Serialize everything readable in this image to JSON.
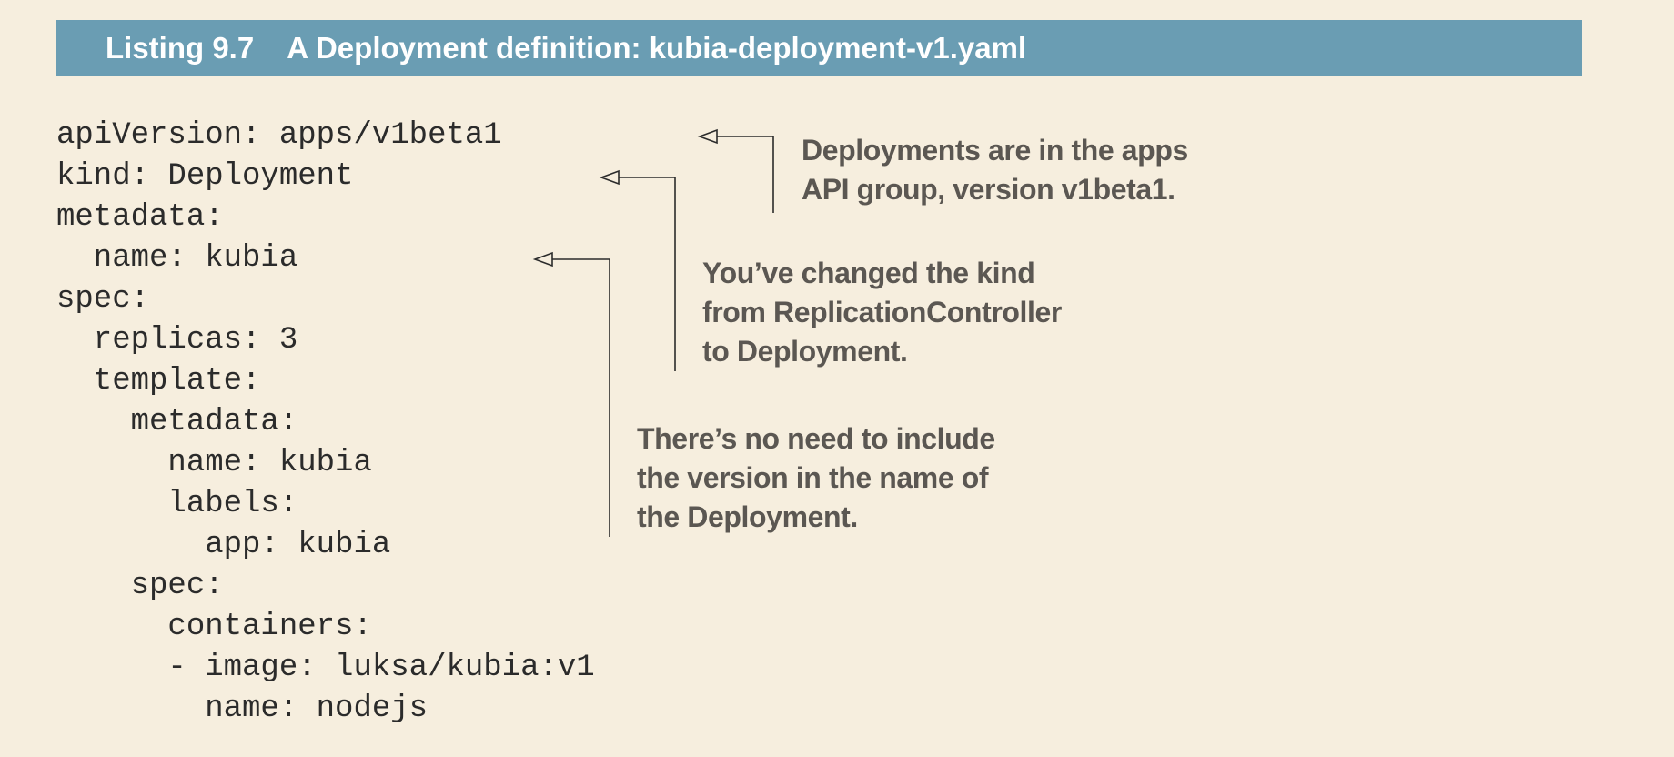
{
  "listing": {
    "number": "Listing 9.7",
    "title": "A Deployment definition: kubia-deployment-v1.yaml"
  },
  "code_lines": [
    "apiVersion: apps/v1beta1",
    "kind: Deployment",
    "metadata:",
    "  name: kubia",
    "spec:",
    "  replicas: 3",
    "  template:",
    "    metadata:",
    "      name: kubia",
    "      labels:",
    "        app: kubia",
    "    spec:",
    "      containers:",
    "      - image: luksa/kubia:v1",
    "        name: nodejs"
  ],
  "callouts": {
    "api_group": [
      "Deployments are in the apps",
      "API group, version v1beta1."
    ],
    "kind_changed": [
      "You’ve changed the kind",
      "from ReplicationController",
      "to Deployment."
    ],
    "no_version": [
      "There’s no need to include",
      "the version in the name of",
      "the Deployment."
    ]
  },
  "colors": {
    "background": "#f6eede",
    "header_bar": "#6a9db3",
    "header_text": "#ffffff",
    "code_text": "#2b2b2b",
    "callout_text": "#5b5752",
    "arrow": "#2b2b2b"
  }
}
